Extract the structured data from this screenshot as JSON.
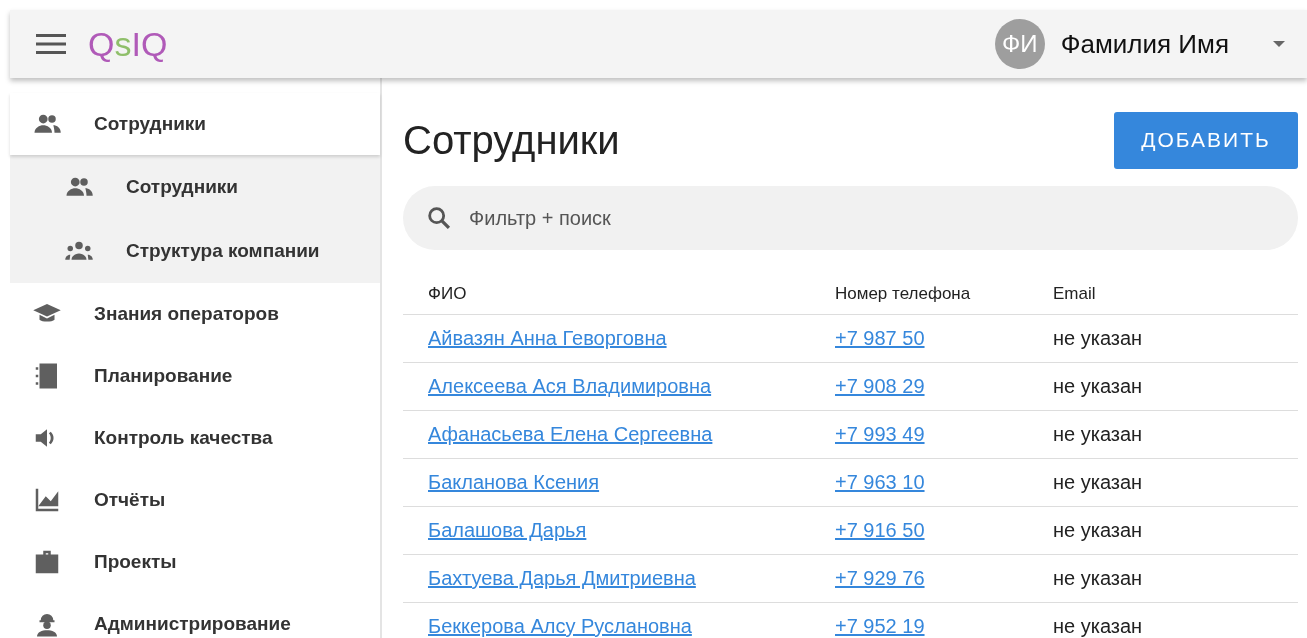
{
  "topbar": {
    "logo": [
      {
        "text": "Q",
        "color": "#b05ab8"
      },
      {
        "text": "s",
        "color": "#8fbf6a"
      },
      {
        "text": "I",
        "color": "#b05ab8"
      },
      {
        "text": "Q",
        "color": "#b05ab8"
      }
    ],
    "user": {
      "initials": "ФИ",
      "name": "Фамилия Имя"
    }
  },
  "sidebar": {
    "items": [
      {
        "label": "Сотрудники",
        "expanded": true,
        "children": [
          {
            "label": "Сотрудники"
          },
          {
            "label": "Структура компании"
          }
        ]
      },
      {
        "label": "Знания операторов"
      },
      {
        "label": "Планирование"
      },
      {
        "label": "Контроль качества"
      },
      {
        "label": "Отчёты"
      },
      {
        "label": "Проекты"
      },
      {
        "label": "Администрирование"
      }
    ]
  },
  "page": {
    "title": "Сотрудники",
    "add_button": "ДОБАВИТЬ",
    "search": {
      "placeholder": "Фильтр + поиск"
    }
  },
  "table": {
    "columns": [
      "ФИО",
      "Номер телефона",
      "Email"
    ],
    "rows": [
      {
        "name": "Айвазян Анна Геворговна",
        "phone": "+7 987 50",
        "email": "не указан"
      },
      {
        "name": "Алексеева Ася Владимировна",
        "phone": "+7 908 29",
        "email": "не указан"
      },
      {
        "name": "Афанасьева Елена Сергеевна",
        "phone": "+7 993 49",
        "email": "не указан"
      },
      {
        "name": "Бакланова Ксения",
        "phone": "+7 963 10",
        "email": "не указан"
      },
      {
        "name": "Балашова Дарья",
        "phone": "+7 916 50",
        "email": "не указан"
      },
      {
        "name": "Бахтуева Дарья Дмитриевна",
        "phone": "+7 929 76",
        "email": "не указан"
      },
      {
        "name": "Беккерова Алсу Руслановна",
        "phone": "+7 952 19",
        "email": "не указан"
      }
    ]
  }
}
